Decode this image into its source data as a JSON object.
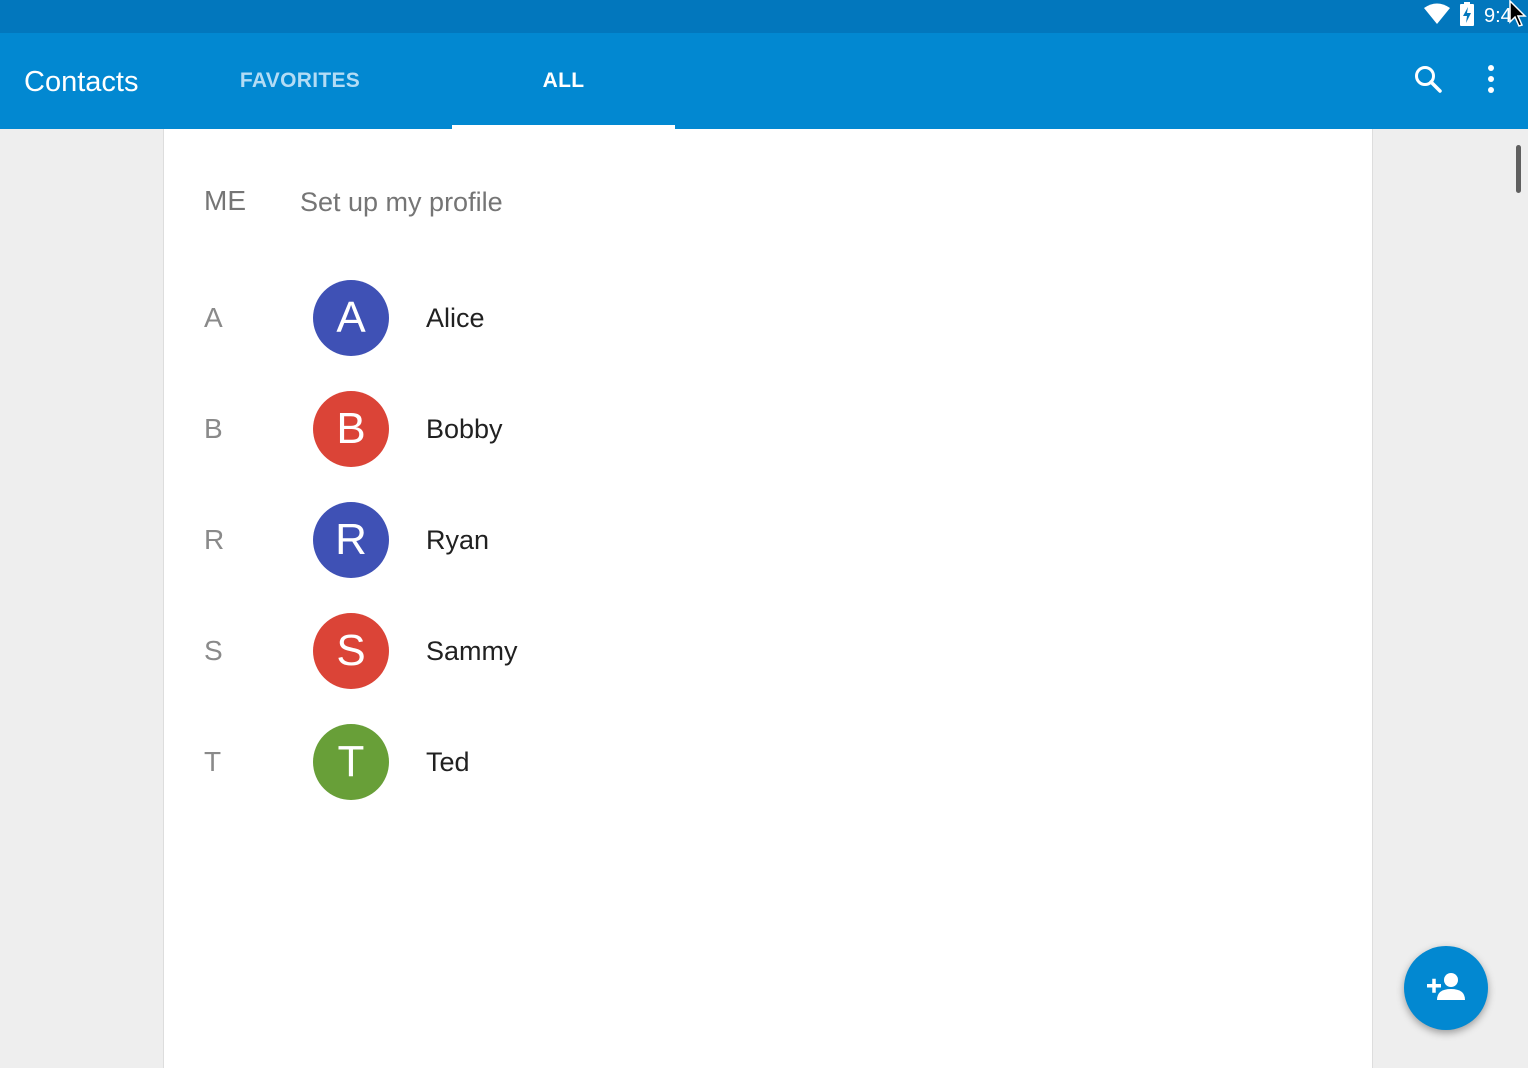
{
  "status_bar": {
    "time": "9:4",
    "icons": [
      "wifi-icon",
      "battery-charging-icon"
    ]
  },
  "app_bar": {
    "title": "Contacts",
    "tabs": [
      {
        "label": "FAVORITES",
        "selected": false
      },
      {
        "label": "ALL",
        "selected": true
      }
    ],
    "actions": [
      "search-icon",
      "more-vert-icon"
    ]
  },
  "profile": {
    "section": "ME",
    "text": "Set up my profile"
  },
  "contacts": [
    {
      "section": "A",
      "initial": "A",
      "name": "Alice",
      "color": "#3f51b5"
    },
    {
      "section": "B",
      "initial": "B",
      "name": "Bobby",
      "color": "#db4437"
    },
    {
      "section": "R",
      "initial": "R",
      "name": "Ryan",
      "color": "#3f51b5"
    },
    {
      "section": "S",
      "initial": "S",
      "name": "Sammy",
      "color": "#db4437"
    },
    {
      "section": "T",
      "initial": "T",
      "name": "Ted",
      "color": "#689f38"
    }
  ],
  "fab": {
    "icon": "add-person-icon"
  },
  "colors": {
    "status_bar": "#0277bd",
    "app_bar": "#0288d1",
    "background": "#eeeeee",
    "card": "#ffffff"
  }
}
